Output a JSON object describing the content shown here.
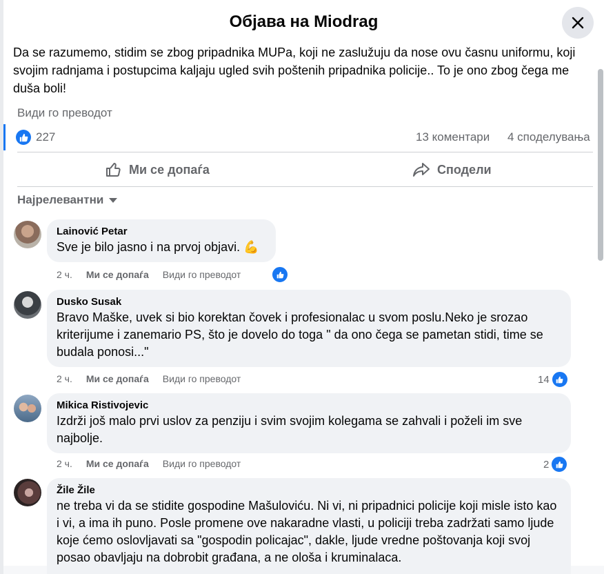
{
  "dialog": {
    "title": "Објава на Miodrag",
    "close_icon": "close-icon"
  },
  "post": {
    "text": "Da se razumemo, stidim se zbog pripadnika MUPa, koji ne zaslužuju da nose ovu časnu uniformu, koji svojim radnjama i postupcima kaljaju ugled svih poštenih pripadnika policije.. To je ono zbog čega me duša boli!",
    "see_translation": "Види го преводот"
  },
  "stats": {
    "likes": "227",
    "comments": "13 коментари",
    "shares": "4 споделувања"
  },
  "actions": {
    "like_label": "Ми се допаѓа",
    "share_label": "Сподели"
  },
  "sort": {
    "label": "Најрелевантни"
  },
  "comments": [
    {
      "author": "Lainović Petar",
      "text": "Sve je bilo jasno i na prvoj objavi. 💪",
      "time": "2 ч.",
      "like": "Ми се допаѓа",
      "translate": "Види го преводот",
      "reactions": ""
    },
    {
      "author": "Dusko Susak",
      "text": "Bravo Maške, uvek si bio korektan čovek i profesionalac u svom poslu.Neko je srozao kriterijume i zanemario PS, što je dovelo do toga \" da ono čega se pametan stidi, time se budala ponosi...\"",
      "time": "2 ч.",
      "like": "Ми се допаѓа",
      "translate": "Види го преводот",
      "reactions": "14"
    },
    {
      "author": "Mikica Ristivojevic",
      "text": "Izdrži još malo prvi uslov za penziju i svim svojim kolegama se zahvali i poželi im sve najbolje.",
      "time": "2 ч.",
      "like": "Ми се допаѓа",
      "translate": "Види го преводот",
      "reactions": "2"
    },
    {
      "author": "Žile Žile",
      "text": "ne treba vi da se stidite gospodine Mašuloviću. Ni vi, ni pripadnici policije koji misle isto kao i vi, a ima ih puno. Posle promene ove nakaradne vlasti, u policiji treba zadržati samo ljude koje ćemo oslovljavati sa \"gospodin policajac\", dakle, ljude vredne poštovanja koji svoj posao obavljaju na dobrobit građana, a ne ološa i kruminalaca."
    }
  ],
  "colors": {
    "accent": "#1877f2",
    "muted": "#65676b",
    "bubble": "#f0f2f5"
  }
}
